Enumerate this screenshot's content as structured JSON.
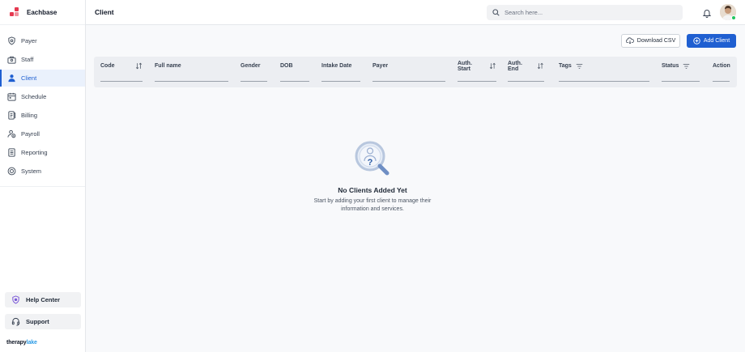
{
  "brand": {
    "name": "Eachbase",
    "color": "#e53950"
  },
  "sidebar": {
    "items": [
      {
        "label": "Payer",
        "icon": "shield-icon"
      },
      {
        "label": "Staff",
        "icon": "staff-icon"
      },
      {
        "label": "Client",
        "icon": "user-icon",
        "active": true
      },
      {
        "label": "Schedule",
        "icon": "calendar-icon"
      },
      {
        "label": "Billing",
        "icon": "billing-icon"
      },
      {
        "label": "Payroll",
        "icon": "payroll-icon"
      },
      {
        "label": "Reporting",
        "icon": "report-icon"
      },
      {
        "label": "System",
        "icon": "system-icon"
      }
    ],
    "help_label": "Help Center",
    "support_label": "Support",
    "footer_logo": {
      "part1": "therapy",
      "part2": "lake"
    }
  },
  "header": {
    "title": "Client",
    "search_placeholder": "Search here..."
  },
  "toolbar": {
    "download_label": "Download CSV",
    "add_label": "Add Client"
  },
  "table": {
    "columns": [
      "Code",
      "Full name",
      "Gender",
      "DOB",
      "Intake Date",
      "Payer",
      "Auth. Start",
      "Auth. End",
      "Tags",
      "Status",
      "Action"
    ]
  },
  "empty_state": {
    "title": "No Clients Added Yet",
    "text": "Start by adding your first client to manage their information and services."
  },
  "colors": {
    "accent": "#1f5fd1",
    "online": "#22c55e"
  }
}
